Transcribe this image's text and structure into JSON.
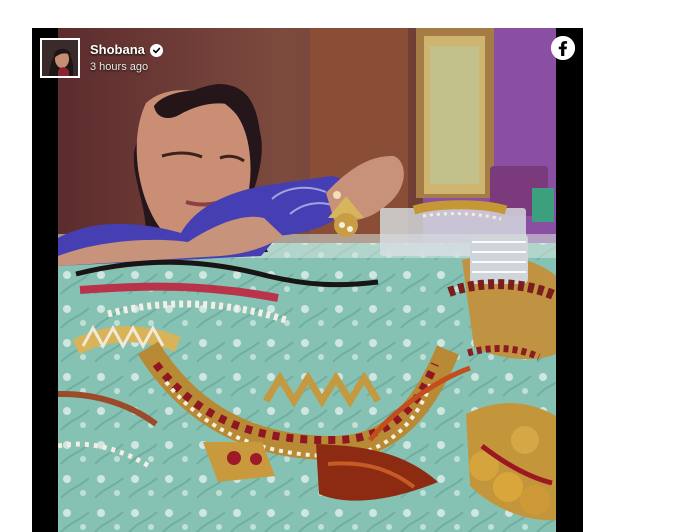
{
  "post": {
    "author": "Shobana",
    "timestamp": "3 hours ago",
    "verified": true,
    "platform_icon": "facebook-icon",
    "avatar_icon": "profile-photo",
    "photo_description_icon": "jewellery-photo"
  },
  "colors": {
    "frame": "#000000",
    "page_bg": "#ffffff",
    "tablecloth": "#8cc7b8",
    "gold": "#c99b3f",
    "ruby": "#9b1a24"
  }
}
